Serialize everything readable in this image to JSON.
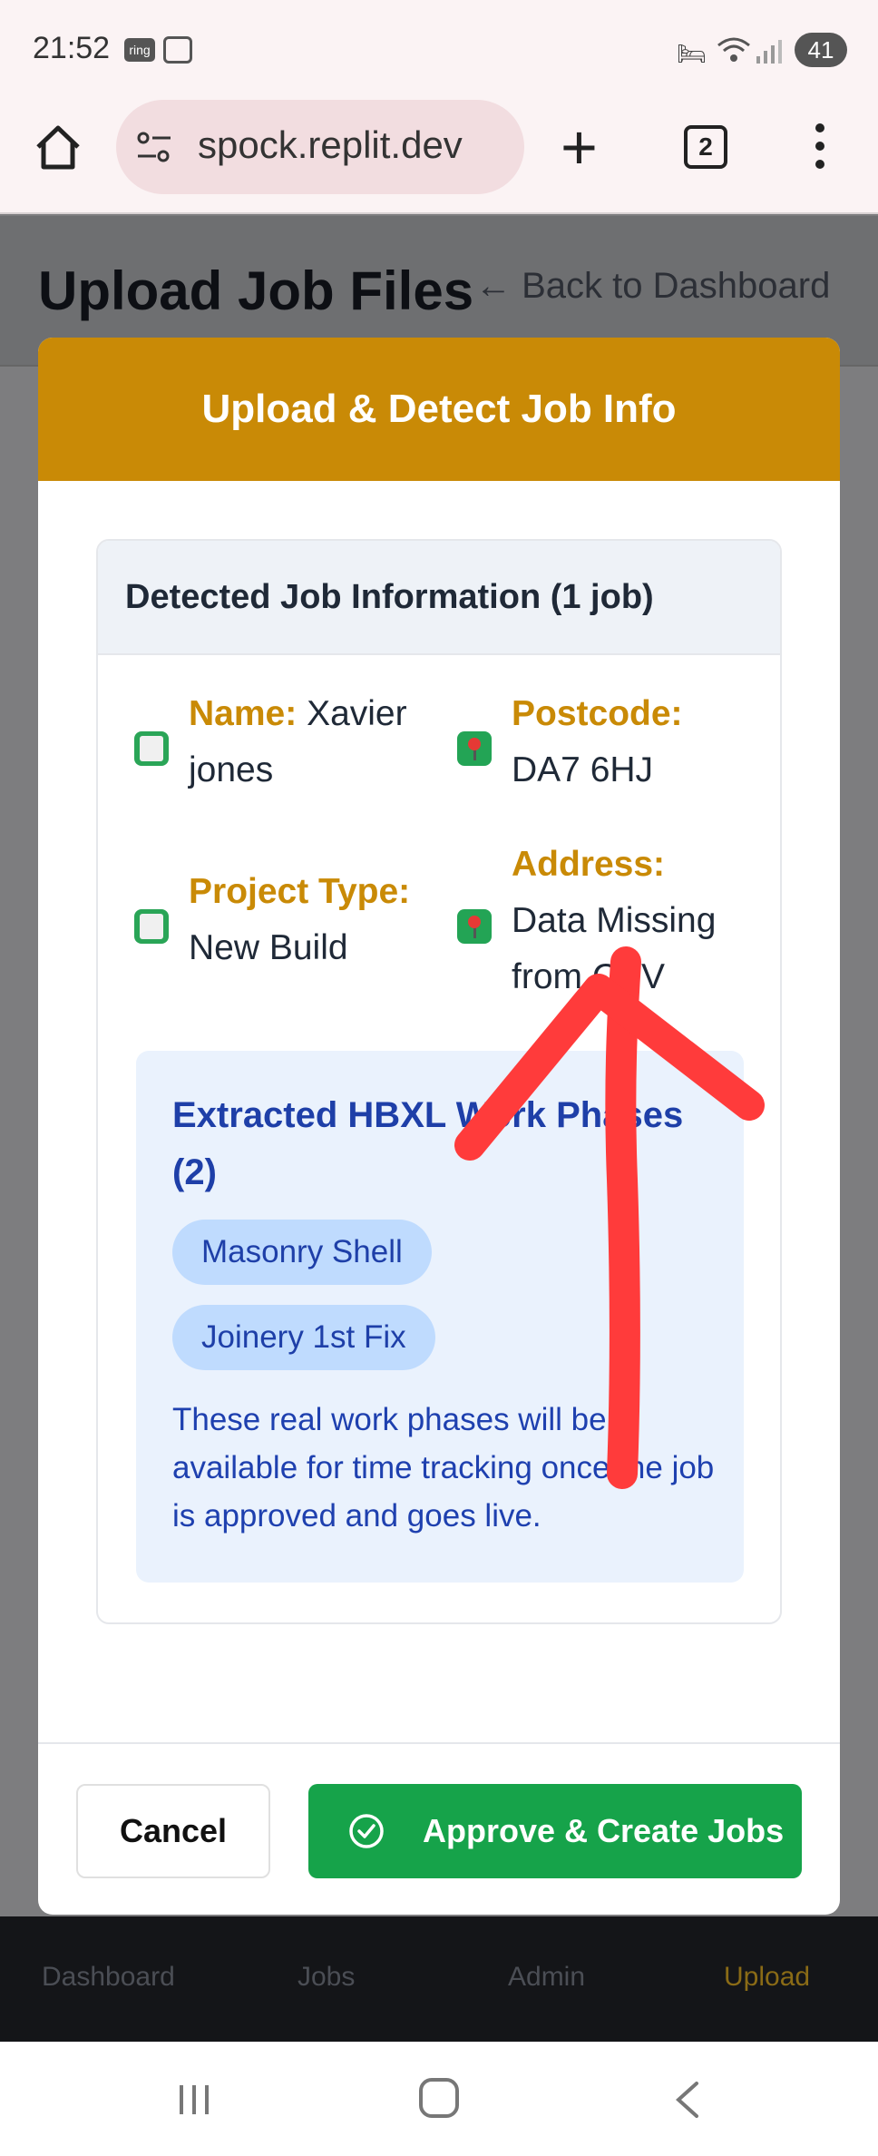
{
  "status_bar": {
    "time": "21:52",
    "ring_label": "ring",
    "battery": "41"
  },
  "browser": {
    "url": "spock.replit.dev",
    "tab_count": "2"
  },
  "page": {
    "title": "Upload Job Files",
    "back_link": "← Back to Dashboard"
  },
  "modal": {
    "title": "Upload & Detect Job Info",
    "card_title": "Detected Job Information (1 job)",
    "fields": {
      "name_label": "Name:",
      "name_value": "Xavier jones",
      "postcode_label": "Postcode:",
      "postcode_value": "DA7 6HJ",
      "project_type_label": "Project Type:",
      "project_type_value": "New Build",
      "address_label": "Address:",
      "address_value": "Data Missing from CSV"
    },
    "phases": {
      "title": "Extracted HBXL Work Phases (2)",
      "items": [
        "Masonry Shell",
        "Joinery 1st Fix"
      ],
      "note": "These real work phases will be available for time tracking once the job is approved and goes live."
    },
    "cancel_label": "Cancel",
    "approve_label": "Approve & Create Jobs"
  },
  "bottom_nav": {
    "items": [
      "Dashboard",
      "Jobs",
      "Admin",
      "Upload"
    ],
    "active": "Upload"
  },
  "colors": {
    "accent": "#c98a06",
    "approve": "#16a34a",
    "phase_text": "#1e3fa8",
    "annotation": "#ff3b3b"
  }
}
